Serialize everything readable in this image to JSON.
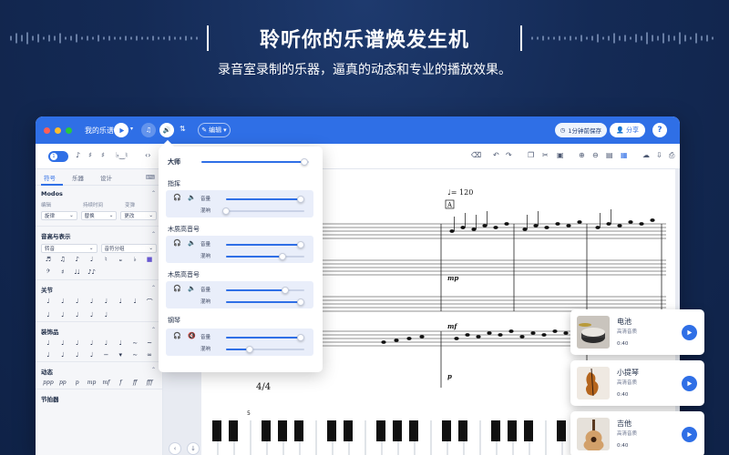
{
  "hero": {
    "title": "聆听你的乐谱焕发生机",
    "subtitle": "录音室录制的乐器，逼真的动态和专业的播放效果。"
  },
  "window": {
    "title": "我的乐谱",
    "edit_label": "编辑",
    "save_status": "1分钟前保存",
    "share_label": "分享",
    "help_label": "?"
  },
  "colors": {
    "accent": "#2f6fe6",
    "background": "#142a55",
    "traffic_red": "#ff5f57",
    "traffic_yellow": "#febc2e",
    "traffic_green": "#28c840"
  },
  "left_panel": {
    "tabs": [
      "符号",
      "乐器",
      "设计"
    ],
    "active_tab": 0,
    "modos": {
      "title": "Modos",
      "labels": [
        "编辑",
        "持续时间",
        "变弹"
      ],
      "values": [
        "旋律",
        "替换",
        "更改"
      ]
    },
    "pitch": {
      "title": "音高与表示",
      "select1": "转音",
      "select2": "音符分组"
    },
    "sections": [
      "关节",
      "装饰品",
      "动态",
      "节拍器"
    ],
    "dynamics": [
      "ppp",
      "pp",
      "p",
      "mp",
      "mf",
      "f",
      "ff",
      "fff"
    ]
  },
  "mixer": {
    "master_label": "大师",
    "master_value": 0.96,
    "groups": [
      {
        "name": "指挥",
        "volume": 0.95,
        "reverb": 0.0,
        "muted": false
      },
      {
        "name": "木质高音号",
        "volume": 0.95,
        "reverb": 0.72,
        "muted": false
      },
      {
        "name": "木质高音号",
        "volume": 0.75,
        "reverb": 0.95,
        "muted": false
      },
      {
        "name": "钢琴",
        "volume": 0.95,
        "reverb": 0.3,
        "muted": true
      }
    ],
    "volume_label": "音量",
    "reverb_label": "混响"
  },
  "score": {
    "tempo": "♩= 120",
    "rehearsal_mark": "A",
    "dynamics": [
      "mp",
      "p",
      "mf"
    ],
    "time_signature": "4/4",
    "measure_number": "5"
  },
  "instruments": [
    {
      "name": "电池",
      "quality": "高清音质",
      "duration": "0:40",
      "icon": "drum-icon"
    },
    {
      "name": "小提琴",
      "quality": "高清音质",
      "duration": "0:40",
      "icon": "violin-icon"
    },
    {
      "name": "吉他",
      "quality": "高清音质",
      "duration": "0:40",
      "icon": "guitar-icon"
    }
  ]
}
